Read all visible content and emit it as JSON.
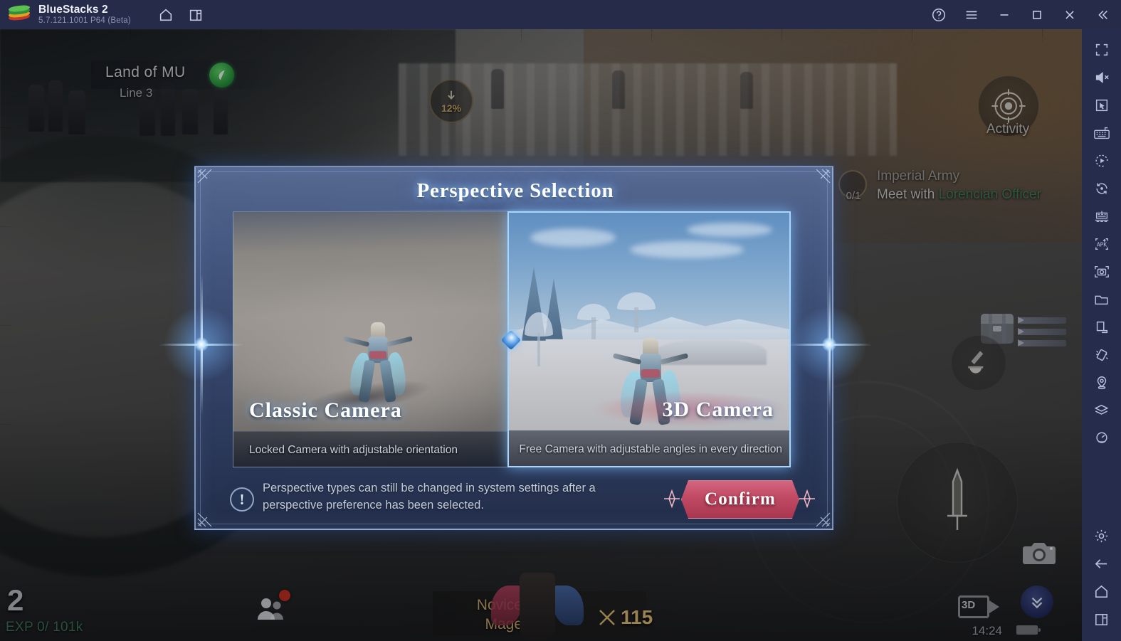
{
  "window": {
    "app_name": "BlueStacks 2",
    "version": "5.7.121.1001  P64 (Beta)",
    "titlebar_icons": [
      {
        "name": "home-icon",
        "label": "Home"
      },
      {
        "name": "multi-instance-icon",
        "label": "Instance Manager"
      }
    ],
    "controls": [
      {
        "name": "help-icon",
        "label": "Help"
      },
      {
        "name": "menu-icon",
        "label": "Menu"
      },
      {
        "name": "minimize-icon",
        "label": "Minimize"
      },
      {
        "name": "maximize-icon",
        "label": "Maximize"
      },
      {
        "name": "close-icon",
        "label": "Close"
      },
      {
        "name": "collapse-sidebar-icon",
        "label": "Collapse"
      }
    ]
  },
  "sidebar": {
    "items": [
      {
        "name": "fullscreen-icon",
        "label": "Full screen"
      },
      {
        "name": "mute-icon",
        "label": "Mute"
      },
      {
        "name": "pointer-icon",
        "label": "Game controls"
      },
      {
        "name": "keyboard-icon",
        "label": "Keyboard controls"
      },
      {
        "name": "macro-icon",
        "label": "Macro recorder"
      },
      {
        "name": "rotate-icon",
        "label": "Rotate"
      },
      {
        "name": "multi-instance-sync-icon",
        "label": "Multi-instance sync"
      },
      {
        "name": "install-apk-icon",
        "label": "Install APK"
      },
      {
        "name": "screenshot-icon",
        "label": "Screenshot"
      },
      {
        "name": "media-folder-icon",
        "label": "Media manager"
      },
      {
        "name": "resize-icon",
        "label": "Resize"
      },
      {
        "name": "shake-icon",
        "label": "Shake"
      },
      {
        "name": "location-icon",
        "label": "Location"
      },
      {
        "name": "layers-icon",
        "label": "Eco mode"
      },
      {
        "name": "performance-icon",
        "label": "Performance"
      },
      {
        "name": "settings-gear-icon",
        "label": "Settings"
      },
      {
        "name": "back-arrow-icon",
        "label": "Back"
      },
      {
        "name": "android-home-icon",
        "label": "Home"
      },
      {
        "name": "recents-icon",
        "label": "Recent apps"
      }
    ]
  },
  "game_hud": {
    "zone_name": "Land of MU",
    "zone_line": "Line 3",
    "leaf_badge": "eco-leaf-icon",
    "download_percent": "12%",
    "activity_label": "Activity",
    "quest": {
      "title": "Imperial Army",
      "objective_prefix": "Meet with ",
      "objective_target": "Lorencian Officer",
      "counter": "0/1"
    },
    "level": "2",
    "exp": "EXP 0/ 101k",
    "class_line1": "Novice",
    "class_line2": "Mage",
    "combat_power": "115",
    "video_3d_label": "3D",
    "clock": "14:24"
  },
  "dialog": {
    "title": "Perspective Selection",
    "options": [
      {
        "name": "Classic Camera",
        "description": "Locked Camera with adjustable orientation",
        "selected": false
      },
      {
        "name": "3D Camera",
        "description": "Free Camera with adjustable angles in every direction",
        "selected": true
      }
    ],
    "note": "Perspective types can still be changed in system settings after a perspective preference has been selected.",
    "warn_symbol": "!",
    "confirm_label": "Confirm"
  },
  "colors": {
    "titlebar": "#252b49",
    "sidebar": "#262c4c",
    "dialog_accent": "#a9d6ff",
    "confirm_red": "#c24c66",
    "quest_target_green": "#3f7a55",
    "exp_green": "#3c6f51",
    "class_gold": "#c4a265"
  }
}
